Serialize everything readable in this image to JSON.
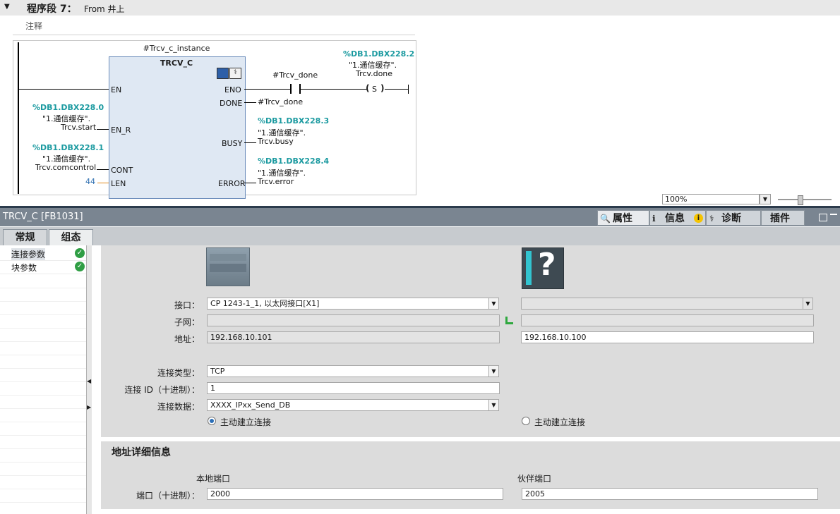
{
  "segment": {
    "arrow": "▼",
    "title": "程序段 7：",
    "subtitle": "From 井上",
    "comment": "注释"
  },
  "block": {
    "instance": "#Trcv_c_instance",
    "name": "TRCV_C",
    "pins_left": [
      "EN",
      "EN_R",
      "CONT",
      "LEN"
    ],
    "pins_right": [
      "ENO",
      "DONE",
      "BUSY",
      "ERROR"
    ]
  },
  "operands": {
    "en_r_addr": "%DB1.DBX228.0",
    "en_r_sym1": "\"1.通信缓存\".",
    "en_r_sym2": "Trcv.start",
    "cont_addr": "%DB1.DBX228.1",
    "cont_sym1": "\"1.通信缓存\".",
    "cont_sym2": "Trcv.comcontrol",
    "len_val": "44",
    "done_val": "#Trcv_done",
    "busy_addr": "%DB1.DBX228.3",
    "busy_sym1": "\"1.通信缓存\".",
    "busy_sym2": "Trcv.busy",
    "error_addr": "%DB1.DBX228.4",
    "error_sym1": "\"1.通信缓存\".",
    "error_sym2": "Trcv.error",
    "contact_label": "#Trcv_done",
    "coil_addr": "%DB1.DBX228.2",
    "coil_sym1": "\"1.通信缓存\".",
    "coil_sym2": "Trcv.done",
    "coil_type": "S"
  },
  "zoom": {
    "value": "100%"
  },
  "inspector": {
    "title": "TRCV_C [FB1031]",
    "tabs": [
      "属性",
      "信息",
      "诊断",
      "插件"
    ],
    "subtabs": [
      "常规",
      "组态"
    ],
    "nav": [
      {
        "label": "连接参数"
      },
      {
        "label": "块参数"
      }
    ]
  },
  "config": {
    "interface_label": "接口：",
    "interface_local": "CP 1243-1_1, 以太网接口[X1]",
    "interface_partner": "",
    "subnet_label": "子网：",
    "subnet_local": "",
    "subnet_partner": "",
    "address_label": "地址：",
    "address_local": "192.168.10.101",
    "address_partner": "192.168.10.100",
    "conn_type_label": "连接类型：",
    "conn_type": "TCP",
    "conn_id_label": "连接 ID（十进制）：",
    "conn_id": "1",
    "conn_data_label": "连接数据：",
    "conn_data": "XXXX_IPxx_Send_DB",
    "active_local": "主动建立连接",
    "active_partner": "主动建立连接",
    "active_local_checked": true,
    "active_partner_checked": false
  },
  "address_details": {
    "title": "地址详细信息",
    "local_port_header": "本地端口",
    "partner_port_header": "伙伴端口",
    "port_label": "端口（十进制）：",
    "local_port": "2000",
    "partner_port": "2005"
  }
}
